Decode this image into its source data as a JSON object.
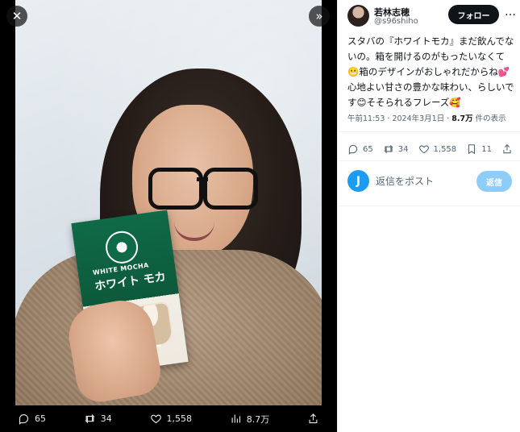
{
  "media": {
    "close_icon": "close-icon",
    "expand_icon": "chevron-double-right-icon",
    "product_box": {
      "label_small": "WHITE MOCHA",
      "label_main": "ホワイト モカ"
    },
    "actions": {
      "reply_count": "65",
      "repost_count": "34",
      "like_count": "1,558",
      "views_count": "8.7万"
    }
  },
  "panel": {
    "user": {
      "name": "若林志穂",
      "handle": "@s96shiho"
    },
    "follow_label": "フォロー",
    "more_label": "…",
    "post": {
      "text": "スタバの『ホワイトモカ』まだ飲んでないの。箱を開けるのがもったいなくて😬箱のデザインがおしゃれだからね💕心地よい甘さの豊かな味わい、らしいです😊そそられるフレーズ🥰"
    },
    "meta": {
      "time": "午前11:53",
      "sep": " · ",
      "date": "2024年3月1日",
      "views_value": "8.7万",
      "views_suffix": " 件の表示"
    },
    "actions": {
      "reply_count": "65",
      "repost_count": "34",
      "like_count": "1,558",
      "bookmark_count": "11"
    },
    "reply_box": {
      "avatar_letter": "J",
      "placeholder": "返信をポスト",
      "button_label": "返信"
    }
  }
}
